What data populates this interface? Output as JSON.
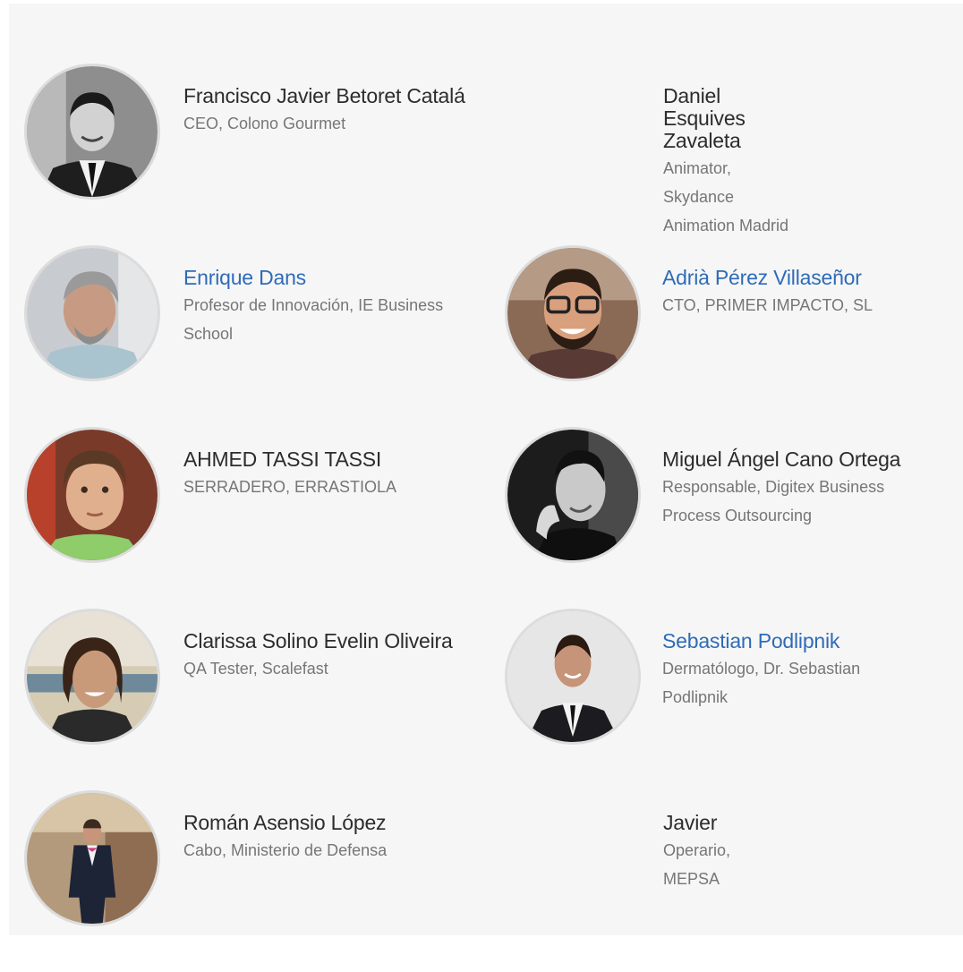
{
  "people": [
    {
      "name": "Francisco Javier Betoret Catalá",
      "role": "CEO, Colono Gourmet",
      "link": false,
      "avatar": "portrait-bw-man-suit-icon"
    },
    {
      "name": "Daniel Esquives Zavaleta",
      "role": "Animator, Skydance Animation Madrid",
      "link": false,
      "avatar": null
    },
    {
      "name": "Enrique Dans",
      "role": "Profesor de Innovación, IE Business School",
      "link": true,
      "avatar": "portrait-grey-hair-man-icon"
    },
    {
      "name": "Adrià Pérez Villaseñor",
      "role": "CTO, PRIMER IMPACTO, SL",
      "link": true,
      "avatar": "portrait-glasses-man-icon"
    },
    {
      "name": "AHMED TASSI TASSI",
      "role": "SERRADERO, ERRASTIOLA",
      "link": false,
      "avatar": "portrait-child-icon"
    },
    {
      "name": "Miguel Ángel Cano Ortega",
      "role": "Responsable, Digitex Business Process Outsourcing",
      "link": false,
      "avatar": "portrait-bw-man-smiling-icon"
    },
    {
      "name": "Clarissa Solino Evelin Oliveira",
      "role": "QA Tester, Scalefast",
      "link": false,
      "avatar": "portrait-woman-outdoor-icon"
    },
    {
      "name": "Sebastian Podlipnik",
      "role": "Dermatólogo, Dr. Sebastian Podlipnik",
      "link": true,
      "avatar": "portrait-man-suit-grey-bg-icon"
    },
    {
      "name": "Román Asensio López",
      "role": "Cabo, Ministerio de Defensa",
      "link": false,
      "avatar": "portrait-man-standing-icon"
    },
    {
      "name": "Javier",
      "role": "Operario, MEPSA",
      "link": false,
      "avatar": null
    }
  ],
  "colors": {
    "link": "#2f6bb8",
    "name": "#2c2c2c",
    "role": "#767676",
    "panel": "#f6f6f6"
  }
}
